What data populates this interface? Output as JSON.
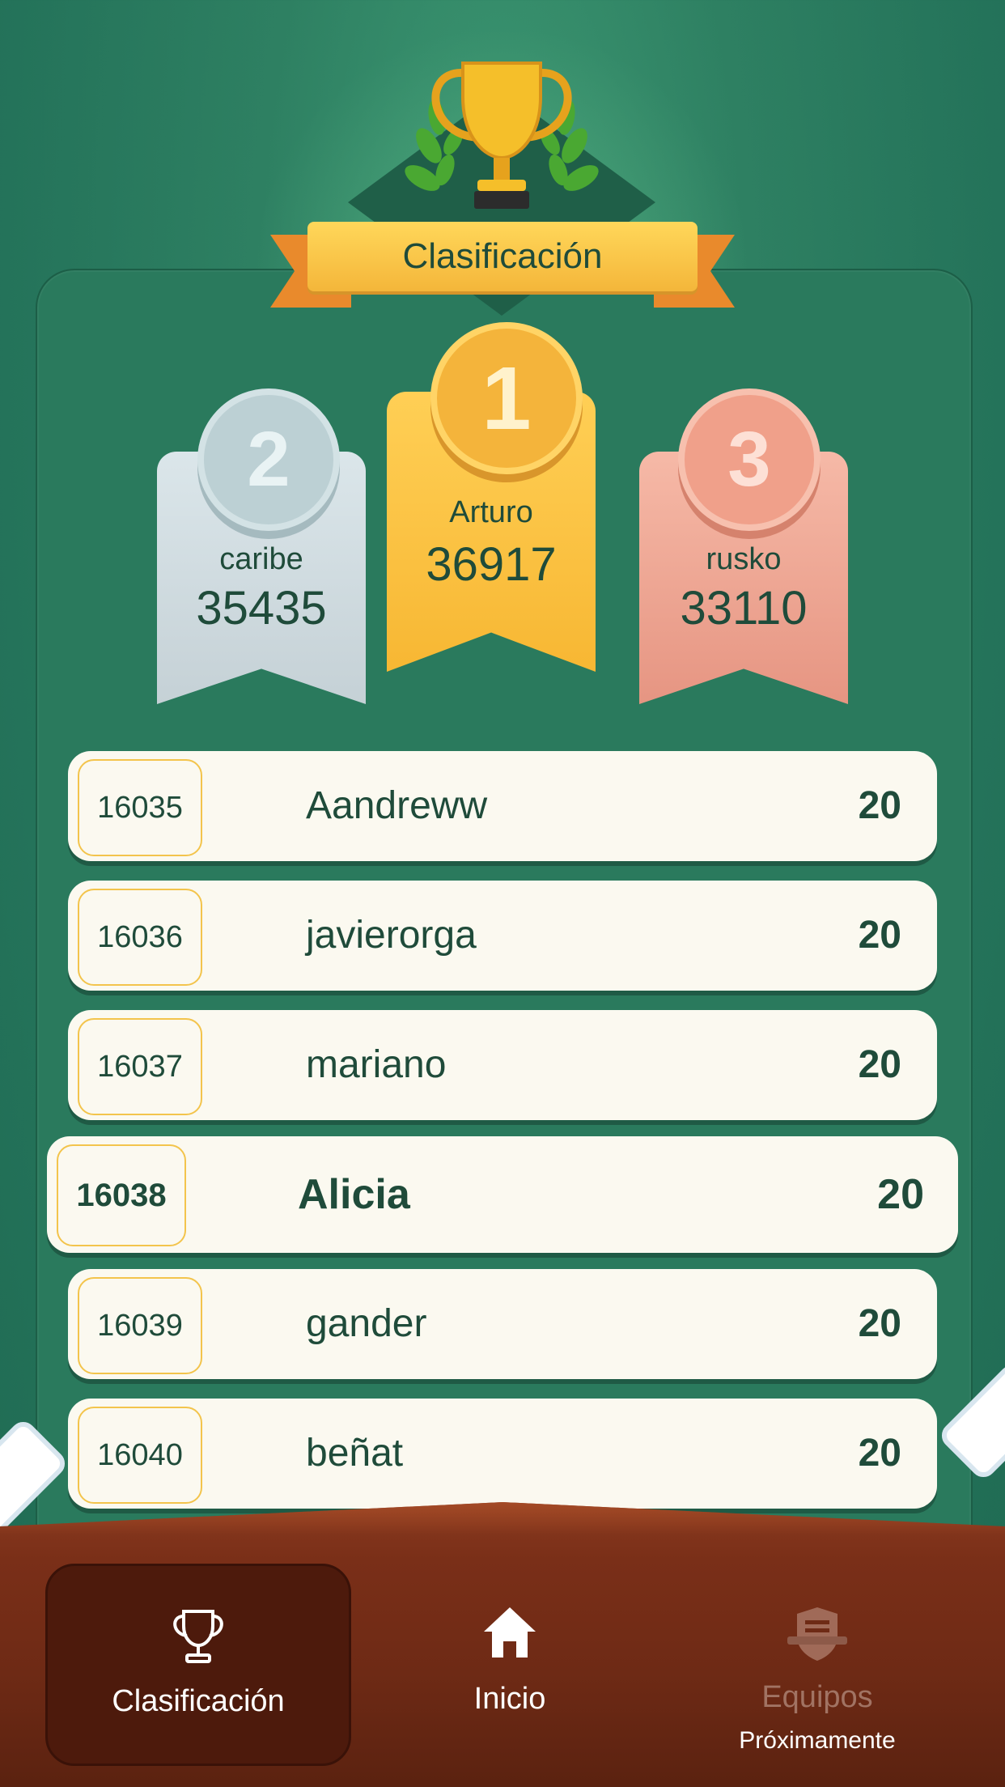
{
  "header": {
    "title": "Clasificación"
  },
  "podium": [
    {
      "position": "2",
      "name": "caribe",
      "score": "35435"
    },
    {
      "position": "1",
      "name": "Arturo",
      "score": "36917"
    },
    {
      "position": "3",
      "name": "rusko",
      "score": "33110"
    }
  ],
  "rows": [
    {
      "rank": "16035",
      "name": "Aandreww",
      "points": "20"
    },
    {
      "rank": "16036",
      "name": "javierorga",
      "points": "20"
    },
    {
      "rank": "16037",
      "name": "mariano",
      "points": "20"
    },
    {
      "rank": "16038",
      "name": "Alicia",
      "points": "20",
      "current_user": true
    },
    {
      "rank": "16039",
      "name": "gander",
      "points": "20"
    },
    {
      "rank": "16040",
      "name": "beñat",
      "points": "20"
    }
  ],
  "nav": {
    "leaderboard": {
      "label": "Clasificación",
      "icon": "trophy-icon",
      "active": true
    },
    "home": {
      "label": "Inicio",
      "icon": "home-icon"
    },
    "teams": {
      "label": "Equipos",
      "sublabel": "Próximamente",
      "icon": "shield-icon",
      "disabled": true
    }
  },
  "colors": {
    "gold": "#f7b733",
    "silver": "#c5d1d6",
    "bronze": "#e69582",
    "background": "#2a7a5d",
    "nav_bar": "#6e2a15"
  }
}
